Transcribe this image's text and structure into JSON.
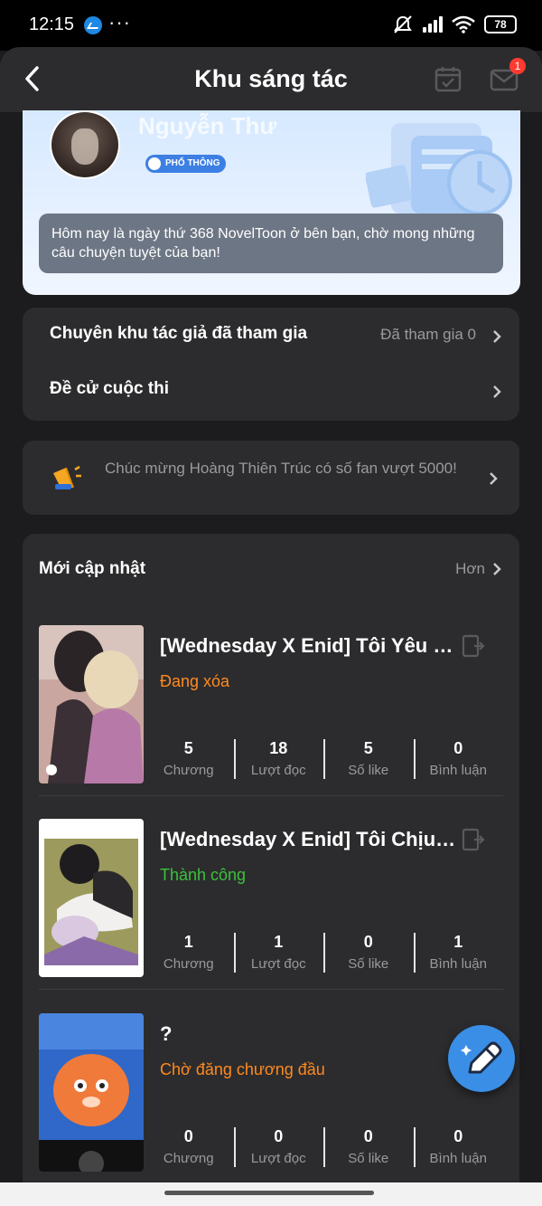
{
  "status_bar": {
    "time": "12:15",
    "dots": "···",
    "battery": "78"
  },
  "header": {
    "title": "Khu sáng tác",
    "mail_badge": "1"
  },
  "profile": {
    "name": "Nguyễn Thư",
    "tier": "PHỔ THÔNG",
    "message": "Hôm nay là ngày thứ 368 NovelToon ở bên bạn, chờ mong những câu chuyện tuyệt của bạn!"
  },
  "menu": {
    "joined_label": "Chuyên khu tác giả đã tham gia",
    "joined_value": "Đã tham gia 0",
    "nominate_label": "Đề cử cuộc thi"
  },
  "announcement": {
    "text": "Chúc mừng Hoàng Thiên Trúc có số fan vượt 5000!"
  },
  "updates": {
    "title": "Mới cập nhật",
    "more": "Hơn",
    "items": [
      {
        "title": "[Wednesday X Enid] Tôi Yêu Em ...",
        "status": "Đang xóa",
        "status_color": "#ff8a1f",
        "stats": [
          {
            "value": "5",
            "label": "Chương"
          },
          {
            "value": "18",
            "label": "Lượt đọc"
          },
          {
            "value": "5",
            "label": "Số like"
          },
          {
            "value": "0",
            "label": "Bình luận"
          }
        ]
      },
      {
        "title": "[Wednesday X Enid] Tôi Chịu Em...",
        "status": "Thành công",
        "status_color": "#3bc23b",
        "stats": [
          {
            "value": "1",
            "label": "Chương"
          },
          {
            "value": "1",
            "label": "Lượt đọc"
          },
          {
            "value": "0",
            "label": "Số like"
          },
          {
            "value": "1",
            "label": "Bình luận"
          }
        ]
      },
      {
        "title": "?",
        "status": "Chờ đăng chương đầu",
        "status_color": "#ff8a1f",
        "stats": [
          {
            "value": "0",
            "label": "Chương"
          },
          {
            "value": "0",
            "label": "Lượt đọc"
          },
          {
            "value": "0",
            "label": "Số like"
          },
          {
            "value": "0",
            "label": "Bình luận"
          }
        ]
      }
    ]
  },
  "icons": {
    "back": "chevron-left-icon",
    "calendar": "calendar-check-icon",
    "mail": "mail-icon",
    "megaphone": "megaphone-icon",
    "edit": "edit-icon",
    "fab": "pencil-sparkle-icon"
  }
}
